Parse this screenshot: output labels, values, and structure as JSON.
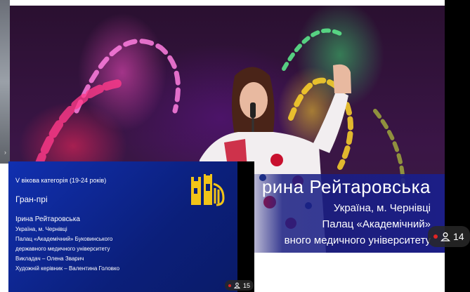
{
  "main_stream": {
    "performer_name": "рина Рейтаровська",
    "line1": "Україна, м. Чернівці",
    "line2": "Палац «Академічний»",
    "line3": "вного медичного університету",
    "viewers": "14"
  },
  "slide": {
    "category": "V вікова категорія (19-24 років)",
    "award": "Гран-прі",
    "laureate": "Ірина Рейтаровська",
    "lines": [
      "Україна, м. Чернівці",
      "Палац «Академічний» Буковинського",
      "державного медичного університету",
      "Викладач – Олена Зварич",
      "Художній керівник – Валентина Головко"
    ],
    "viewers": "15"
  },
  "icons": [
    "live-dot-icon",
    "person-icon",
    "lyre-logo-icon"
  ],
  "colors": {
    "slide_bg": "#0b1f7a",
    "logo_gold": "#f2c418",
    "live_red": "#e02424"
  }
}
